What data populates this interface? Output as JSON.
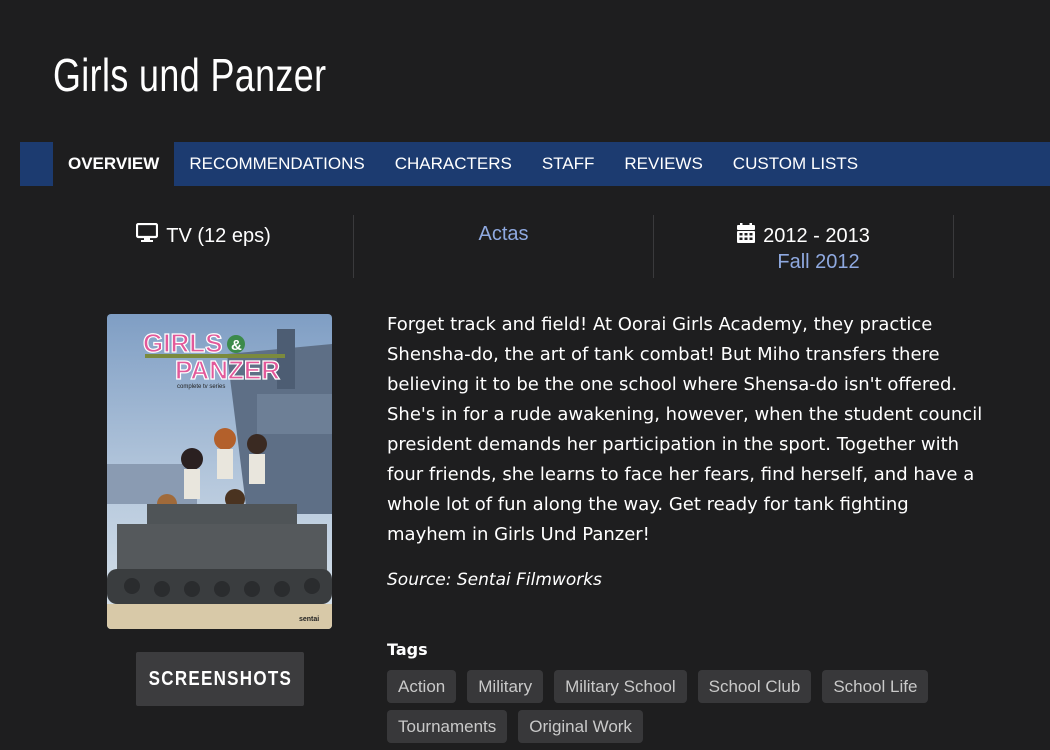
{
  "title": "Girls und Panzer",
  "tabs": [
    {
      "label": "OVERVIEW",
      "active": true
    },
    {
      "label": "RECOMMENDATIONS"
    },
    {
      "label": "CHARACTERS"
    },
    {
      "label": "STAFF"
    },
    {
      "label": "REVIEWS"
    },
    {
      "label": "CUSTOM LISTS"
    }
  ],
  "stats": {
    "type": {
      "icon": "monitor-icon",
      "text": "TV (12 eps)"
    },
    "studio": {
      "text": "Actas"
    },
    "dates": {
      "icon": "calendar-icon",
      "text": "2012 - 2013",
      "season": "Fall 2012"
    }
  },
  "poster": {
    "logo_line1": "GIRLS",
    "logo_amp": "&",
    "logo_line2": "PANZER",
    "subtitle": "complete tv series",
    "publisher": "sentai"
  },
  "screenshots_button": "SCREENSHOTS",
  "synopsis": "Forget track and field! At Oorai Girls Academy, they practice Shensha-do, the art of tank combat! But Miho transfers there believing it to be the one school where Shensa-do isn't offered. She's in for a rude awakening, however, when the student council president demands her participation in the sport. Together with four friends, she learns to face her fears, find herself, and have a whole lot of fun along the way. Get ready for tank fighting mayhem in Girls Und Panzer!",
  "source": "Source: Sentai Filmworks",
  "tags_label": "Tags",
  "tags": [
    "Action",
    "Military",
    "Military School",
    "School Club",
    "School Life",
    "Tournaments",
    "Original Work"
  ],
  "colors": {
    "nav": "#1c3b70",
    "background": "#1e1e1f",
    "link": "#8fa9e0",
    "tag_bg": "#38383a"
  }
}
